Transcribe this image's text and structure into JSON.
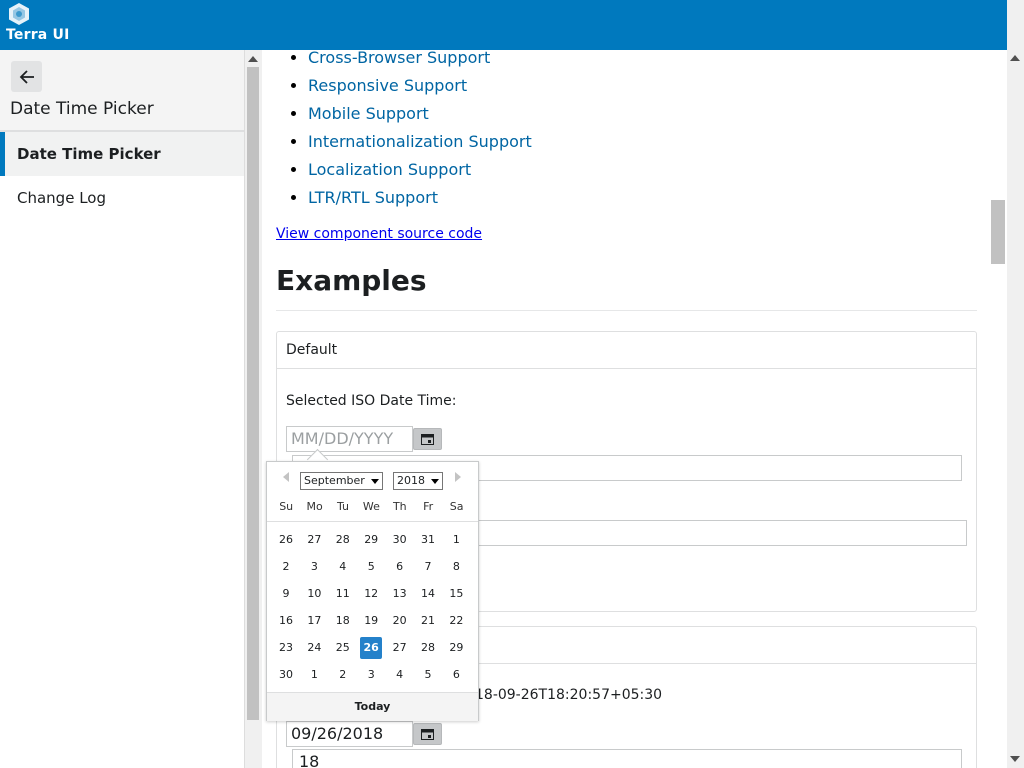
{
  "header": {
    "title": "Terra UI",
    "color": "#0079be"
  },
  "sidebar": {
    "heading": "Date Time Picker",
    "items": [
      {
        "label": "Date Time Picker",
        "active": true
      },
      {
        "label": "Change Log",
        "active": false
      }
    ]
  },
  "main": {
    "features": [
      "Cross-Browser Support",
      "Responsive Support",
      "Mobile Support",
      "Internationalization Support",
      "Localization Support",
      "LTR/RTL Support"
    ],
    "source_link": "View component source code",
    "examples_title": "Examples",
    "card1": {
      "header": "Default",
      "label": "Selected ISO Date Time:",
      "date_placeholder": "MM/DD/YYYY"
    },
    "card2": {
      "iso_value_visible": "18-09-26T18:20:57+05:30",
      "date_value": "09/26/2018",
      "hour_value": "18"
    }
  },
  "picker": {
    "month": "September",
    "year": "2018",
    "weekdays": [
      "Su",
      "Mo",
      "Tu",
      "We",
      "Th",
      "Fr",
      "Sa"
    ],
    "weeks": [
      [
        "26",
        "27",
        "28",
        "29",
        "30",
        "31",
        "1"
      ],
      [
        "2",
        "3",
        "4",
        "5",
        "6",
        "7",
        "8"
      ],
      [
        "9",
        "10",
        "11",
        "12",
        "13",
        "14",
        "15"
      ],
      [
        "16",
        "17",
        "18",
        "19",
        "20",
        "21",
        "22"
      ],
      [
        "23",
        "24",
        "25",
        "26",
        "27",
        "28",
        "29"
      ],
      [
        "30",
        "1",
        "2",
        "3",
        "4",
        "5",
        "6"
      ]
    ],
    "selected_day": "26",
    "today_label": "Today",
    "selected_color": "#2481ca"
  }
}
